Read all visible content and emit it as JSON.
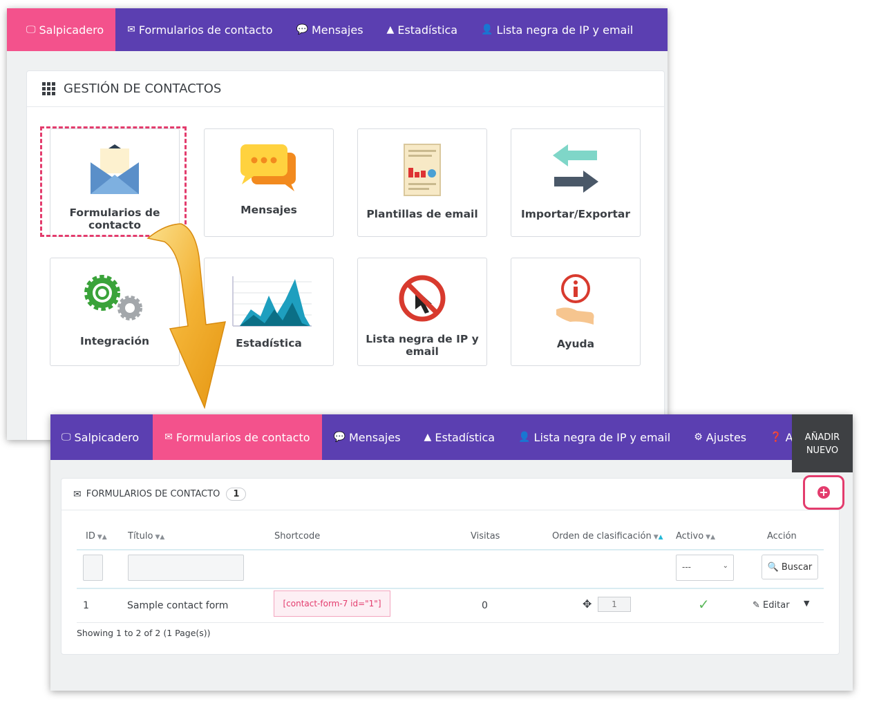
{
  "top_screen": {
    "nav": [
      {
        "label": "Salpicadero",
        "icon": "desktop-icon",
        "active": true
      },
      {
        "label": "Formularios de contacto",
        "icon": "envelope-icon",
        "active": false
      },
      {
        "label": "Mensajes",
        "icon": "comments-icon",
        "active": false
      },
      {
        "label": "Estadística",
        "icon": "area-chart-icon",
        "active": false
      },
      {
        "label": "Lista negra de IP y email",
        "icon": "user-block-icon",
        "active": false
      }
    ],
    "panel_title": "GESTIÓN DE CONTACTOS",
    "tiles": [
      {
        "label_1": "Formularios de",
        "label_2": "contacto",
        "icon": "envelope-icon"
      },
      {
        "label_1": "Mensajes",
        "icon": "chat-bubbles-icon"
      },
      {
        "label_1": "Plantillas de email",
        "icon": "document-chart-icon"
      },
      {
        "label_1": "Importar/Exportar",
        "icon": "swap-arrows-icon"
      },
      {
        "label_1": "Integración",
        "icon": "gears-icon"
      },
      {
        "label_1": "Estadística",
        "icon": "area-chart-icon"
      },
      {
        "label_1": "Lista negra de IP y",
        "label_2": "email",
        "icon": "block-cursor-icon"
      },
      {
        "label_1": "Ayuda",
        "icon": "info-hand-icon"
      }
    ]
  },
  "bottom_screen": {
    "nav": [
      {
        "label": "Salpicadero",
        "icon": "desktop-icon",
        "active": false
      },
      {
        "label": "Formularios de contacto",
        "icon": "envelope-icon",
        "active": true
      },
      {
        "label": "Mensajes",
        "icon": "comments-icon",
        "active": false
      },
      {
        "label": "Estadística",
        "icon": "area-chart-icon",
        "active": false
      },
      {
        "label": "Lista negra de IP y email",
        "icon": "user-block-icon",
        "active": false
      },
      {
        "label": "Ajustes",
        "icon": "gear-icon",
        "active": false
      },
      {
        "label": "Ayuda",
        "icon": "question-icon",
        "active": false
      }
    ],
    "add_new_line1": "AÑADIR",
    "add_new_line2": "NUEVO",
    "panel_title": "FORMULARIOS DE CONTACTO",
    "count": "1",
    "columns": [
      "ID",
      "Título",
      "Shortcode",
      "Visitas",
      "Orden de clasificación",
      "Activo",
      "Acción"
    ],
    "filter": {
      "active_select": "---",
      "search_label": "Buscar"
    },
    "rows": [
      {
        "id": "1",
        "title": "Sample contact form",
        "shortcode": "[contact-form-7 id=\"1\"]",
        "visits": "0",
        "position": "1",
        "active": "✓",
        "action": "Editar"
      }
    ],
    "footer": "Showing 1 to 2 of 2 (1 Page(s))"
  },
  "colors": {
    "nav_bg": "#5b3fb1",
    "active_tab": "#f3528c",
    "highlight": "#e33c6d",
    "accent": "#25b9d7"
  }
}
